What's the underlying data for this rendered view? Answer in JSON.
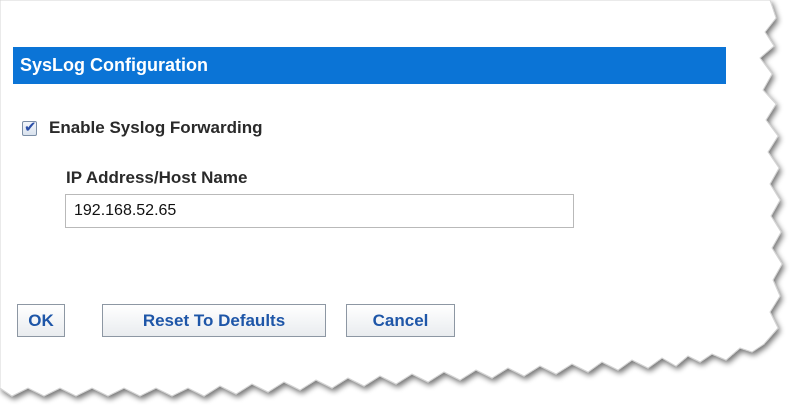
{
  "section": {
    "title": "SysLog Configuration"
  },
  "syslog": {
    "enable_label": "Enable Syslog Forwarding",
    "enabled": true,
    "host_label": "IP Address/Host Name",
    "host_value": "192.168.52.65"
  },
  "buttons": {
    "ok_label": "OK",
    "reset_label": "Reset To Defaults",
    "cancel_label": "Cancel"
  },
  "colors": {
    "header_bg": "#0b74d6",
    "button_text": "#1e56a8"
  }
}
